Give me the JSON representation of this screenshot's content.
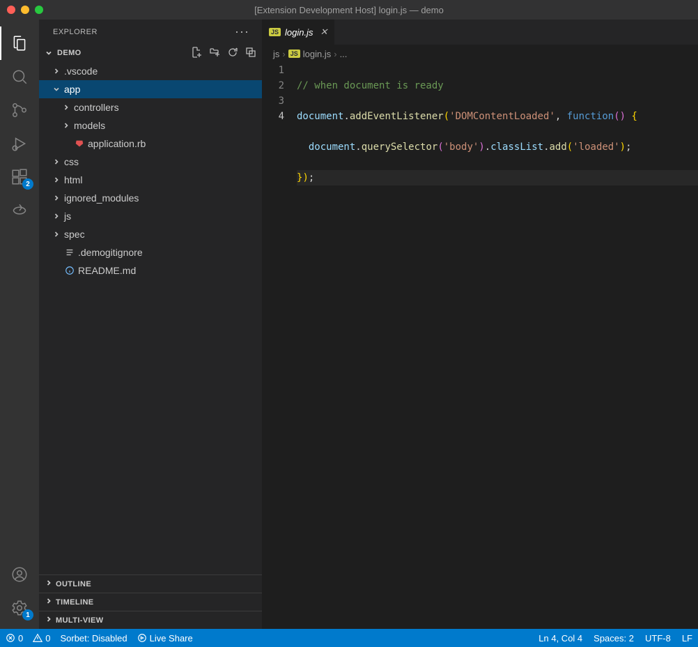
{
  "titlebar": "[Extension Development Host] login.js — demo",
  "sidebar": {
    "title": "EXPLORER",
    "section": "DEMO",
    "collapsed_sections": [
      "OUTLINE",
      "TIMELINE",
      "MULTI-VIEW"
    ]
  },
  "tree": [
    {
      "depth": 0,
      "type": "folder",
      "expand": "closed",
      "label": ".vscode"
    },
    {
      "depth": 0,
      "type": "folder",
      "expand": "open",
      "label": "app",
      "selected": true
    },
    {
      "depth": 1,
      "type": "folder",
      "expand": "closed",
      "label": "controllers"
    },
    {
      "depth": 1,
      "type": "folder",
      "expand": "closed",
      "label": "models"
    },
    {
      "depth": 1,
      "type": "file",
      "icon": "ruby",
      "label": "application.rb"
    },
    {
      "depth": 0,
      "type": "folder",
      "expand": "closed",
      "label": "css"
    },
    {
      "depth": 0,
      "type": "folder",
      "expand": "closed",
      "label": "html"
    },
    {
      "depth": 0,
      "type": "folder",
      "expand": "closed",
      "label": "ignored_modules"
    },
    {
      "depth": 0,
      "type": "folder",
      "expand": "closed",
      "label": "js"
    },
    {
      "depth": 0,
      "type": "folder",
      "expand": "closed",
      "label": "spec"
    },
    {
      "depth": 0,
      "type": "file",
      "icon": "lines",
      "label": ".demogitignore"
    },
    {
      "depth": 0,
      "type": "file",
      "icon": "info",
      "label": "README.md"
    }
  ],
  "tab": {
    "filename": "login.js",
    "lang_badge": "JS"
  },
  "breadcrumb": {
    "folder": "js",
    "lang_badge": "JS",
    "file": "login.js",
    "tail": "..."
  },
  "code": {
    "lines": [
      "1",
      "2",
      "3",
      "4"
    ],
    "active_line": "4",
    "l1_comment": "// when document is ready",
    "l2": {
      "obj": "document",
      "dot": ".",
      "fn": "addEventListener",
      "lp": "(",
      "str": "'DOMContentLoaded'",
      "comma": ", ",
      "kw": "function",
      "lp2": "()",
      "sp": " ",
      "brace": "{"
    },
    "l3": {
      "indent": "  ",
      "obj": "document",
      "dot": ".",
      "fn": "querySelector",
      "lp": "(",
      "str": "'body'",
      "rp": ")",
      "dot2": ".",
      "prop": "classList",
      "dot3": ".",
      "fn2": "add",
      "lp2": "(",
      "str2": "'loaded'",
      "rp2": ")",
      "semi": ";"
    },
    "l4": {
      "brace": "}",
      "rp": ")",
      "semi": ";"
    }
  },
  "activity_badges": {
    "extensions": "2",
    "settings": "1"
  },
  "status": {
    "errors": "0",
    "warnings": "0",
    "sorbet": "Sorbet: Disabled",
    "liveshare": "Live Share",
    "ln_col": "Ln 4, Col 4",
    "spaces": "Spaces: 2",
    "encoding": "UTF-8",
    "eol": "LF"
  }
}
